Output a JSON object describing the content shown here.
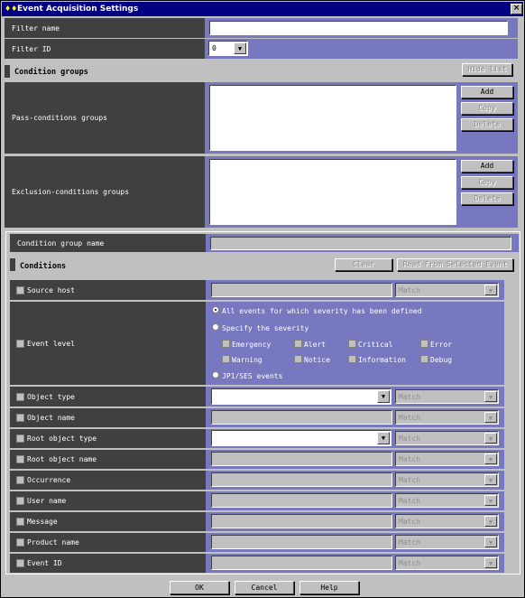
{
  "window": {
    "title": "Event Acquisition Settings",
    "close": "×"
  },
  "filter": {
    "name_label": "Filter name",
    "name_value": "",
    "id_label": "Filter ID",
    "id_value": "0"
  },
  "condition_groups": {
    "title": "Condition groups",
    "hide_list": "Hide list",
    "pass_label": "Pass-conditions groups",
    "exclusion_label": "Exclusion-conditions groups",
    "add": "Add",
    "copy": "Copy",
    "delete": "Delete"
  },
  "condition_group_name": {
    "label": "Condition group name",
    "value": ""
  },
  "conditions": {
    "title": "Conditions",
    "clear": "Clear",
    "read_from": "Read From Selected Event"
  },
  "rows": [
    {
      "label": "Source host",
      "match": "Match"
    },
    {
      "label": "Event level"
    },
    {
      "label": "Object type",
      "match": "Match"
    },
    {
      "label": "Object name",
      "match": "Match"
    },
    {
      "label": "Root object type",
      "match": "Match"
    },
    {
      "label": "Root object name",
      "match": "Match"
    },
    {
      "label": "Occurrence",
      "match": "Match"
    },
    {
      "label": "User name",
      "match": "Match"
    },
    {
      "label": "Message",
      "match": "Match"
    },
    {
      "label": "Product name",
      "match": "Match"
    },
    {
      "label": "Event ID",
      "match": "Match"
    }
  ],
  "event_level": {
    "all": "All events for which severity has been defined",
    "specify": "Specify the severity",
    "jp1": "JP1/SES events",
    "severities": [
      "Emergency",
      "Alert",
      "Critical",
      "Error",
      "Warning",
      "Notice",
      "Information",
      "Debug"
    ]
  },
  "footer": {
    "ok": "OK",
    "cancel": "Cancel",
    "help": "Help"
  },
  "colors": {
    "label_bg": "#404040",
    "row_bg": "#7878c0",
    "title_bg": "#000080"
  }
}
